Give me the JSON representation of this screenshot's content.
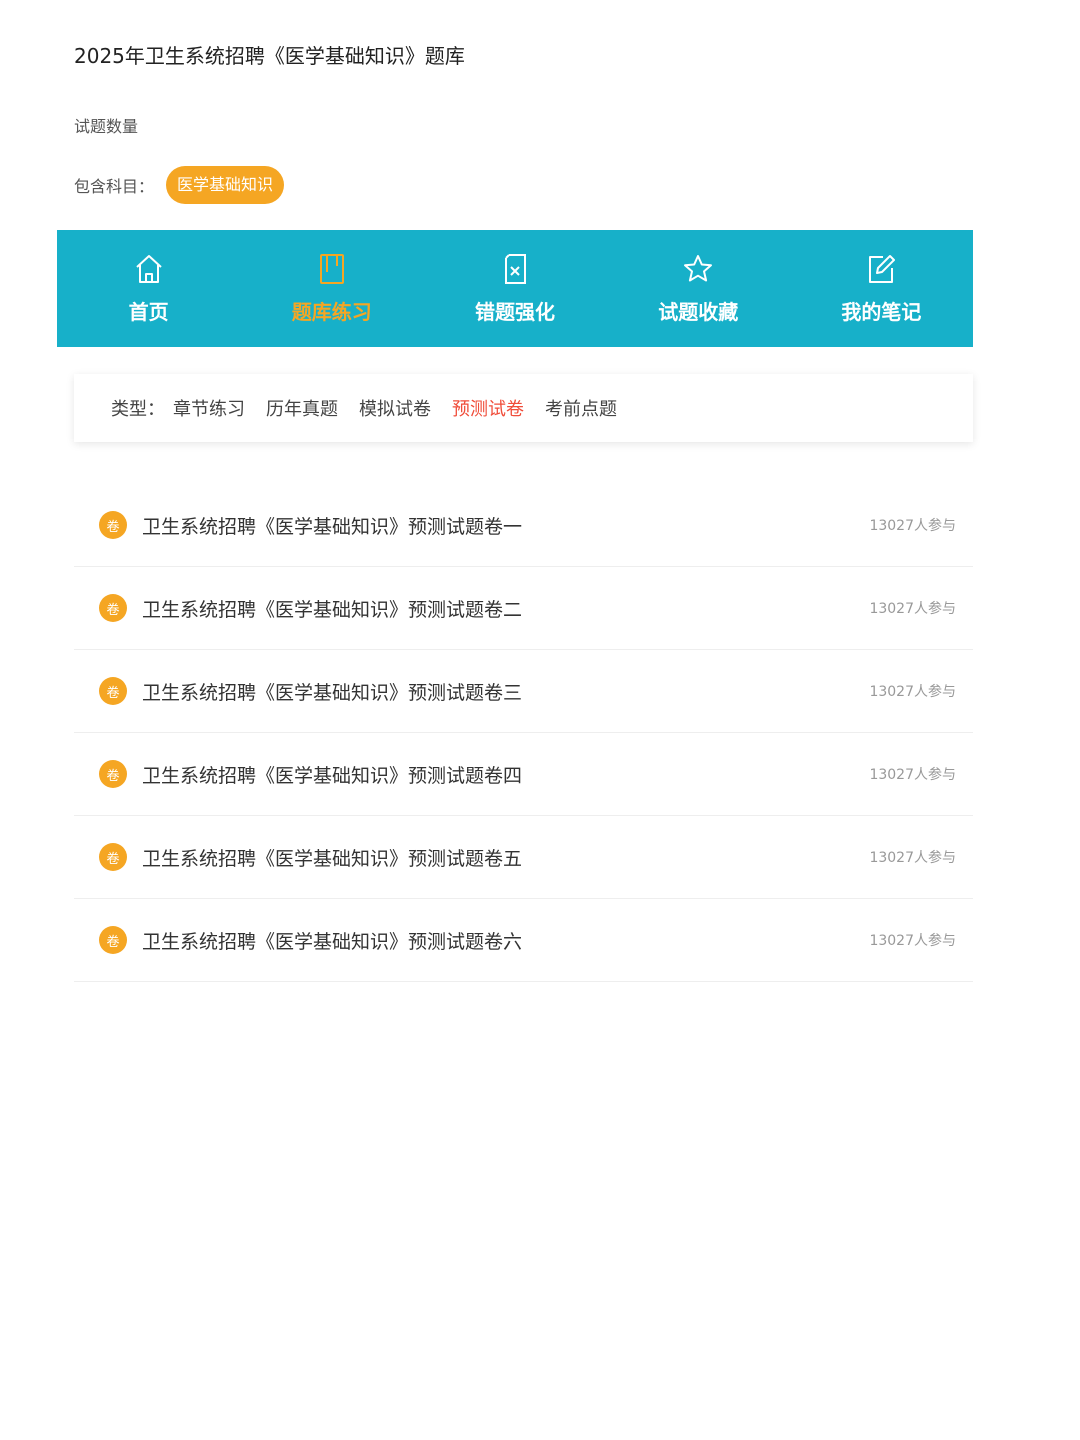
{
  "page": {
    "title": "2025年卫生系统招聘《医学基础知识》题库",
    "count_label": "试题数量",
    "subject_label": "包含科目：",
    "subject_tag": "医学基础知识"
  },
  "colors": {
    "nav_bg": "#17b0c9",
    "accent": "#f5a623",
    "active_type": "#f04d3a"
  },
  "nav": {
    "items": [
      {
        "label": "首页",
        "icon": "home-icon"
      },
      {
        "label": "题库练习",
        "icon": "book-icon",
        "active": true
      },
      {
        "label": "错题强化",
        "icon": "wrong-question-icon"
      },
      {
        "label": "试题收藏",
        "icon": "star-icon"
      },
      {
        "label": "我的笔记",
        "icon": "note-edit-icon"
      }
    ]
  },
  "types": {
    "label": "类型：",
    "options": [
      "章节练习",
      "历年真题",
      "模拟试卷",
      "预测试卷",
      "考前点题"
    ],
    "active": "预测试卷"
  },
  "exams": {
    "badge": "卷",
    "items": [
      {
        "title": "卫生系统招聘《医学基础知识》预测试题卷一",
        "count": "13027人参与"
      },
      {
        "title": "卫生系统招聘《医学基础知识》预测试题卷二",
        "count": "13027人参与"
      },
      {
        "title": "卫生系统招聘《医学基础知识》预测试题卷三",
        "count": "13027人参与"
      },
      {
        "title": "卫生系统招聘《医学基础知识》预测试题卷四",
        "count": "13027人参与"
      },
      {
        "title": "卫生系统招聘《医学基础知识》预测试题卷五",
        "count": "13027人参与"
      },
      {
        "title": "卫生系统招聘《医学基础知识》预测试题卷六",
        "count": "13027人参与"
      }
    ]
  }
}
